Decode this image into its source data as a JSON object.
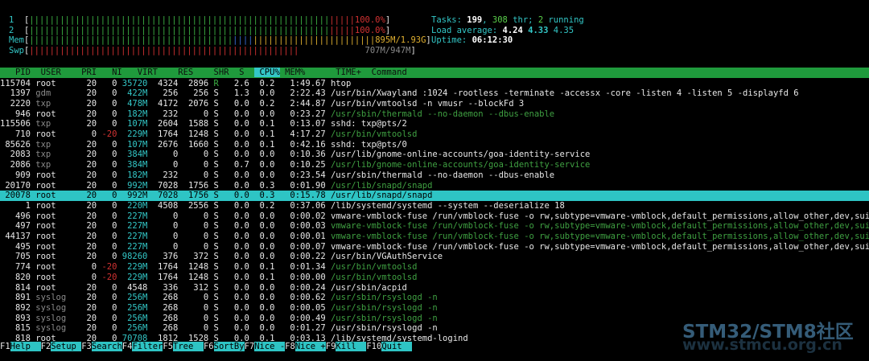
{
  "meters": {
    "cpu1": {
      "label": "1",
      "percent": "100.0%"
    },
    "cpu2": {
      "label": "2",
      "percent": "100.0%"
    },
    "mem": {
      "label": "Mem",
      "value": "895M/1.93G"
    },
    "swp": {
      "label": "Swp",
      "value": "707M/947M"
    }
  },
  "summary": {
    "tasks_label": "Tasks:",
    "tasks": "199",
    "threads": "308",
    "thr_label": "thr;",
    "running": "2",
    "running_label": "running",
    "load_label": "Load average:",
    "load1": "4.24",
    "load5": "4.33",
    "load15": "4.35",
    "uptime_label": "Uptime:",
    "uptime": "06:12:30"
  },
  "columns": [
    "PID",
    "USER",
    "PRI",
    "NI",
    "VIRT",
    "RES",
    "SHR",
    "S",
    "CPU%",
    "MEM%",
    "TIME+",
    "Command"
  ],
  "processes": [
    {
      "pid": "115704",
      "user": "root",
      "pri": "20",
      "ni": "0",
      "virt": "35720",
      "res": "4324",
      "shr": "2896",
      "s": "R",
      "cpu": "2.6",
      "mem": "0.2",
      "time": "1:49.67",
      "cmd": "htop"
    },
    {
      "pid": "1397",
      "user": "gdm",
      "pri": "20",
      "ni": "0",
      "virt": "422M",
      "res": "256",
      "shr": "256",
      "s": "S",
      "cpu": "1.3",
      "mem": "0.0",
      "time": "2:22.43",
      "cmd": "/usr/bin/Xwayland :1024 -rootless -terminate -accessx -core -listen 4 -listen 5 -displayfd 6"
    },
    {
      "pid": "2220",
      "user": "txp",
      "pri": "20",
      "ni": "0",
      "virt": "478M",
      "res": "4172",
      "shr": "2076",
      "s": "S",
      "cpu": "0.0",
      "mem": "0.2",
      "time": "2:44.87",
      "cmd": "/usr/bin/vmtoolsd -n vmusr --blockFd 3"
    },
    {
      "pid": "946",
      "user": "root",
      "pri": "20",
      "ni": "0",
      "virt": "182M",
      "res": "232",
      "shr": "0",
      "s": "S",
      "cpu": "0.0",
      "mem": "0.0",
      "time": "0:23.27",
      "cmd": "/usr/sbin/thermald --no-daemon --dbus-enable"
    },
    {
      "pid": "115506",
      "user": "txp",
      "pri": "20",
      "ni": "0",
      "virt": "107M",
      "res": "2604",
      "shr": "1588",
      "s": "S",
      "cpu": "0.0",
      "mem": "0.1",
      "time": "0:13.07",
      "cmd": "sshd: txp@pts/2"
    },
    {
      "pid": "710",
      "user": "root",
      "pri": "0",
      "ni": "-20",
      "virt": "229M",
      "res": "1764",
      "shr": "1248",
      "s": "S",
      "cpu": "0.0",
      "mem": "0.1",
      "time": "4:17.27",
      "cmd": "/usr/bin/vmtoolsd"
    },
    {
      "pid": "85626",
      "user": "txp",
      "pri": "20",
      "ni": "0",
      "virt": "107M",
      "res": "2676",
      "shr": "1660",
      "s": "S",
      "cpu": "0.0",
      "mem": "0.1",
      "time": "0:42.16",
      "cmd": "sshd: txp@pts/0"
    },
    {
      "pid": "2083",
      "user": "txp",
      "pri": "20",
      "ni": "0",
      "virt": "384M",
      "res": "0",
      "shr": "0",
      "s": "S",
      "cpu": "0.0",
      "mem": "0.0",
      "time": "0:10.36",
      "cmd": "/usr/lib/gnome-online-accounts/goa-identity-service"
    },
    {
      "pid": "2086",
      "user": "txp",
      "pri": "20",
      "ni": "0",
      "virt": "384M",
      "res": "0",
      "shr": "0",
      "s": "S",
      "cpu": "0.7",
      "mem": "0.0",
      "time": "0:10.25",
      "cmd": "/usr/lib/gnome-online-accounts/goa-identity-service"
    },
    {
      "pid": "909",
      "user": "root",
      "pri": "20",
      "ni": "0",
      "virt": "182M",
      "res": "232",
      "shr": "0",
      "s": "S",
      "cpu": "0.0",
      "mem": "0.0",
      "time": "0:23.54",
      "cmd": "/usr/sbin/thermald --no-daemon --dbus-enable"
    },
    {
      "pid": "20170",
      "user": "root",
      "pri": "20",
      "ni": "0",
      "virt": "992M",
      "res": "7028",
      "shr": "1756",
      "s": "S",
      "cpu": "0.0",
      "mem": "0.3",
      "time": "0:01.90",
      "cmd": "/usr/lib/snapd/snapd"
    },
    {
      "pid": "20078",
      "user": "root",
      "pri": "20",
      "ni": "0",
      "virt": "992M",
      "res": "7028",
      "shr": "1756",
      "s": "S",
      "cpu": "0.0",
      "mem": "0.3",
      "time": "0:15.78",
      "cmd": "/usr/lib/snapd/snapd"
    },
    {
      "pid": "1",
      "user": "root",
      "pri": "20",
      "ni": "0",
      "virt": "220M",
      "res": "4508",
      "shr": "2556",
      "s": "S",
      "cpu": "0.0",
      "mem": "0.2",
      "time": "0:37.06",
      "cmd": "/lib/systemd/systemd --system --deserialize 18"
    },
    {
      "pid": "496",
      "user": "root",
      "pri": "20",
      "ni": "0",
      "virt": "227M",
      "res": "0",
      "shr": "0",
      "s": "S",
      "cpu": "0.0",
      "mem": "0.0",
      "time": "0:00.02",
      "cmd": "vmware-vmblock-fuse /run/vmblock-fuse -o rw,subtype=vmware-vmblock,default_permissions,allow_other,dev,suid"
    },
    {
      "pid": "497",
      "user": "root",
      "pri": "20",
      "ni": "0",
      "virt": "227M",
      "res": "0",
      "shr": "0",
      "s": "S",
      "cpu": "0.0",
      "mem": "0.0",
      "time": "0:00.03",
      "cmd": "vmware-vmblock-fuse /run/vmblock-fuse -o rw,subtype=vmware-vmblock,default_permissions,allow_other,dev,suid"
    },
    {
      "pid": "44137",
      "user": "root",
      "pri": "20",
      "ni": "0",
      "virt": "227M",
      "res": "0",
      "shr": "0",
      "s": "S",
      "cpu": "0.0",
      "mem": "0.0",
      "time": "0:00.01",
      "cmd": "vmware-vmblock-fuse /run/vmblock-fuse -o rw,subtype=vmware-vmblock,default_permissions,allow_other,dev,suid"
    },
    {
      "pid": "495",
      "user": "root",
      "pri": "20",
      "ni": "0",
      "virt": "227M",
      "res": "0",
      "shr": "0",
      "s": "S",
      "cpu": "0.0",
      "mem": "0.0",
      "time": "0:00.07",
      "cmd": "vmware-vmblock-fuse /run/vmblock-fuse -o rw,subtype=vmware-vmblock,default_permissions,allow_other,dev,suid"
    },
    {
      "pid": "705",
      "user": "root",
      "pri": "20",
      "ni": "0",
      "virt": "98260",
      "res": "376",
      "shr": "372",
      "s": "S",
      "cpu": "0.0",
      "mem": "0.0",
      "time": "0:00.22",
      "cmd": "/usr/bin/VGAuthService"
    },
    {
      "pid": "774",
      "user": "root",
      "pri": "0",
      "ni": "-20",
      "virt": "229M",
      "res": "1764",
      "shr": "1248",
      "s": "S",
      "cpu": "0.0",
      "mem": "0.1",
      "time": "0:01.34",
      "cmd": "/usr/bin/vmtoolsd"
    },
    {
      "pid": "820",
      "user": "root",
      "pri": "0",
      "ni": "-20",
      "virt": "229M",
      "res": "1764",
      "shr": "1248",
      "s": "S",
      "cpu": "0.0",
      "mem": "0.1",
      "time": "0:00.00",
      "cmd": "/usr/bin/vmtoolsd"
    },
    {
      "pid": "814",
      "user": "root",
      "pri": "20",
      "ni": "0",
      "virt": "4548",
      "res": "336",
      "shr": "312",
      "s": "S",
      "cpu": "0.0",
      "mem": "0.0",
      "time": "0:00.24",
      "cmd": "/usr/sbin/acpid"
    },
    {
      "pid": "891",
      "user": "syslog",
      "pri": "20",
      "ni": "0",
      "virt": "256M",
      "res": "268",
      "shr": "0",
      "s": "S",
      "cpu": "0.0",
      "mem": "0.0",
      "time": "0:00.62",
      "cmd": "/usr/sbin/rsyslogd -n"
    },
    {
      "pid": "892",
      "user": "syslog",
      "pri": "20",
      "ni": "0",
      "virt": "256M",
      "res": "268",
      "shr": "0",
      "s": "S",
      "cpu": "0.0",
      "mem": "0.0",
      "time": "0:00.05",
      "cmd": "/usr/sbin/rsyslogd -n"
    },
    {
      "pid": "893",
      "user": "syslog",
      "pri": "20",
      "ni": "0",
      "virt": "256M",
      "res": "268",
      "shr": "0",
      "s": "S",
      "cpu": "0.0",
      "mem": "0.0",
      "time": "0:00.49",
      "cmd": "/usr/sbin/rsyslogd -n"
    },
    {
      "pid": "815",
      "user": "syslog",
      "pri": "20",
      "ni": "0",
      "virt": "256M",
      "res": "268",
      "shr": "0",
      "s": "S",
      "cpu": "0.0",
      "mem": "0.0",
      "time": "0:01.27",
      "cmd": "/usr/sbin/rsyslogd -n"
    },
    {
      "pid": "818",
      "user": "root",
      "pri": "20",
      "ni": "0",
      "virt": "70708",
      "res": "1812",
      "shr": "1528",
      "s": "S",
      "cpu": "0.0",
      "mem": "0.1",
      "time": "0:03.13",
      "cmd": "/lib/systemd/systemd-logind"
    }
  ],
  "footer": [
    {
      "key": "F1",
      "label": "Help"
    },
    {
      "key": "F2",
      "label": "Setup"
    },
    {
      "key": "F3",
      "label": "Search"
    },
    {
      "key": "F4",
      "label": "Filter"
    },
    {
      "key": "F5",
      "label": "Tree"
    },
    {
      "key": "F6",
      "label": "SortBy"
    },
    {
      "key": "F7",
      "label": "Nice -"
    },
    {
      "key": "F8",
      "label": "Nice +"
    },
    {
      "key": "F9",
      "label": "Kill"
    },
    {
      "key": "F10",
      "label": "Quit"
    }
  ],
  "watermark": {
    "line1": "STM32/STM8社区",
    "line2": "www.stmcu.org.cn"
  }
}
